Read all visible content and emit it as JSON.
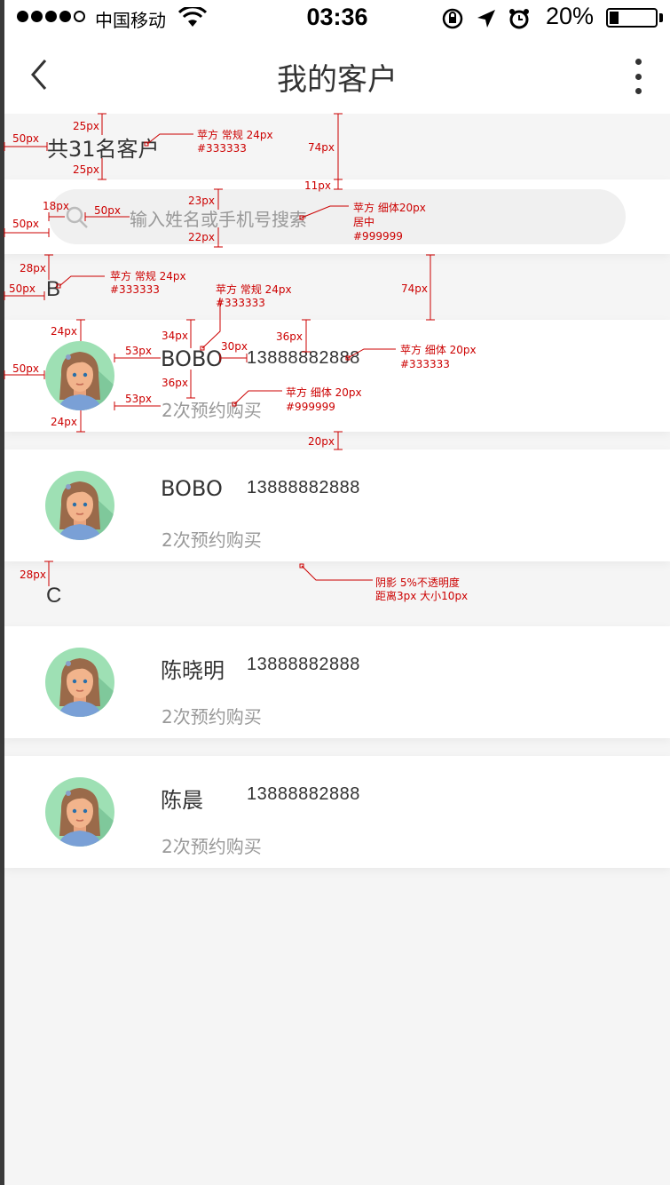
{
  "status_bar": {
    "carrier": "中国移动",
    "time": "03:36",
    "battery_pct": "20%",
    "battery_level": 0.2,
    "signal_bars_filled": 4,
    "signal_bars_total": 5
  },
  "nav": {
    "title": "我的客户",
    "back_icon": "chevron-left-icon",
    "more_icon": "vertical-ellipsis-icon"
  },
  "summary": {
    "count_text": "共31名客户"
  },
  "search": {
    "placeholder": "输入姓名或手机号搜索",
    "icon": "search-icon"
  },
  "sections": [
    {
      "letter": "B",
      "customers": [
        {
          "name": "BOBO",
          "phone": "13888882888",
          "subtitle": "2次预约购买"
        },
        {
          "name": "BOBO",
          "phone": "13888882888",
          "subtitle": "2次预约购买"
        }
      ]
    },
    {
      "letter": "C",
      "customers": [
        {
          "name": "陈晓明",
          "phone": "13888882888",
          "subtitle": "2次预约购买"
        },
        {
          "name": "陈晨",
          "phone": "13888882888",
          "subtitle": "2次预约购买"
        }
      ]
    }
  ],
  "annotations": {
    "a1": "50px",
    "a2": "25px",
    "a3": "25px",
    "a4": "苹方 常规 24px",
    "a5": "#333333",
    "a6": "74px",
    "a7": "11px",
    "a8": "18px",
    "a9": "50px",
    "a10": "23px",
    "a11": "苹方 细体20px",
    "a12": "居中",
    "a13": "#999999",
    "a14": "50px",
    "a15": "22px",
    "a16": "28px",
    "a17": "苹方 常规 24px",
    "a18": "#333333",
    "a19": "50px",
    "a20": "苹方 常规 24px",
    "a21": "#333333",
    "a22": "74px",
    "a23": "24px",
    "a24": "34px",
    "a25": "53px",
    "a26": "36px",
    "a27": "30px",
    "a28": "苹方 细体 20px",
    "a29": "#333333",
    "a30": "50px",
    "a31": "36px",
    "a32": "53px",
    "a33": "苹方 细体 20px",
    "a34": "#999999",
    "a35": "24px",
    "a36": "20px",
    "a37": "28px",
    "a38": "阴影 5%不透明度",
    "a39": "距离3px  大小10px"
  },
  "colors": {
    "text_primary": "#333333",
    "text_secondary": "#999999",
    "background": "#f5f5f5",
    "annotation": "#cc0000"
  }
}
